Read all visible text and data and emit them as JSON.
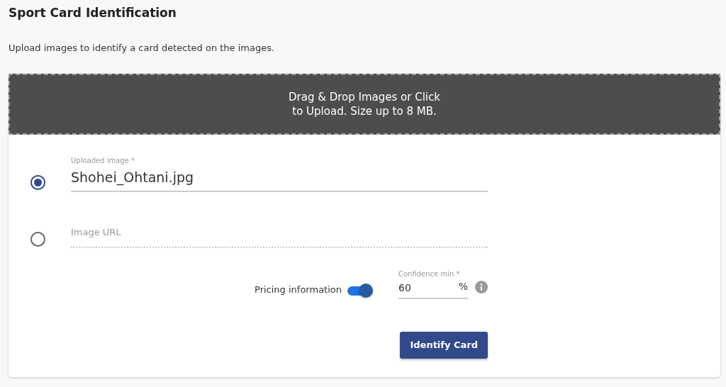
{
  "title": "Sport Card Identification",
  "description": "Upload images to identify a card detected on the images.",
  "dropzone": {
    "text": "Drag & Drop Images or Click to Upload. Size up to 8 MB."
  },
  "sources": [
    {
      "kind": "upload",
      "selected": true,
      "label": "Uploaded image *",
      "value": "Shohei_Ohtani.jpg"
    },
    {
      "kind": "url",
      "selected": false,
      "placeholder": "Image URL"
    }
  ],
  "pricing": {
    "label": "Pricing information",
    "on": true
  },
  "confidence": {
    "label": "Confidence min *",
    "value": "60",
    "suffix": "%"
  },
  "submit": {
    "label": "Identify Card"
  }
}
